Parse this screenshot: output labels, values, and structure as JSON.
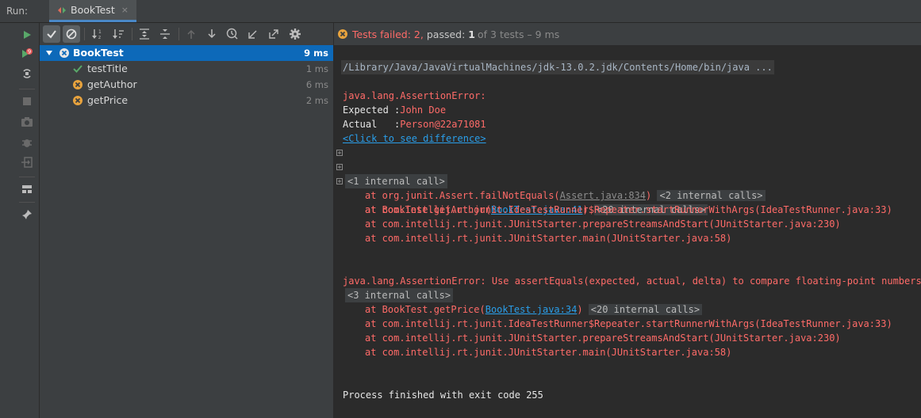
{
  "run_label": "Run:",
  "run_tab": {
    "label": "BookTest",
    "close": "×"
  },
  "tree": {
    "root": {
      "name": "BookTest",
      "time": "9 ms"
    },
    "children": [
      {
        "name": "testTitle",
        "time": "1 ms",
        "status": "passed"
      },
      {
        "name": "getAuthor",
        "time": "6 ms",
        "status": "failed"
      },
      {
        "name": "getPrice",
        "time": "2 ms",
        "status": "failed"
      }
    ]
  },
  "status": {
    "failed_text": "Tests failed: 2,",
    "passed_prefix": "passed:",
    "passed_count": "1",
    "of_text": "of 3 tests – 9 ms"
  },
  "console": {
    "command": "/Library/Java/JavaVirtualMachines/jdk-13.0.2.jdk/Contents/Home/bin/java ...",
    "err1": {
      "title": "java.lang.AssertionError:",
      "expected_label": "Expected :",
      "expected_value": "John Doe",
      "actual_label": "Actual   :",
      "actual_value": "Person@22a71081",
      "diff_link": "<Click to see difference>",
      "fold1": "<1 internal call>",
      "frame1_prefix": "at org.junit.Assert.failNotEquals(",
      "frame1_link": "Assert.java:834",
      "frame1_suffix": ")",
      "frame1_fold": "<2 internal calls>",
      "frame2_prefix": "at BookTest.getAuthor(",
      "frame2_link": "BookTest.java:41",
      "frame2_suffix": ")",
      "frame2_fold": "<20 internal calls>",
      "frame3": "at com.intellij.rt.junit.IdeaTestRunner$Repeater.startRunnerWithArgs(IdeaTestRunner.java:33)",
      "frame4": "at com.intellij.rt.junit.JUnitStarter.prepareStreamsAndStart(JUnitStarter.java:230)",
      "frame5": "at com.intellij.rt.junit.JUnitStarter.main(JUnitStarter.java:58)"
    },
    "err2": {
      "title": "java.lang.AssertionError: Use assertEquals(expected, actual, delta) to compare floating-point numbers",
      "fold1": "<3 internal calls>",
      "frame1_prefix": "at BookTest.getPrice(",
      "frame1_link": "BookTest.java:34",
      "frame1_suffix": ")",
      "frame1_fold": "<20 internal calls>",
      "frame2": "at com.intellij.rt.junit.IdeaTestRunner$Repeater.startRunnerWithArgs(IdeaTestRunner.java:33)",
      "frame3": "at com.intellij.rt.junit.JUnitStarter.prepareStreamsAndStart(JUnitStarter.java:230)",
      "frame4": "at com.intellij.rt.junit.JUnitStarter.main(JUnitStarter.java:58)"
    },
    "exit": "Process finished with exit code 255"
  },
  "colors": {
    "error": "#ff6b68",
    "link": "#2a9ee9",
    "selection": "#0d69b9",
    "pass": "#59a869",
    "fail_icon": "#e8a33d"
  },
  "icons": {
    "strip": [
      "rerun-icon",
      "rerun-failed-icon",
      "toggle-auto-test-icon",
      "stop-icon",
      "screenshot-icon",
      "debug-icon",
      "exit-icon",
      "layout-icon",
      "pin-icon"
    ],
    "toolbar": [
      "show-passed-icon",
      "show-ignored-icon",
      "sort-alpha-icon",
      "sort-duration-icon",
      "expand-all-icon",
      "collapse-all-icon",
      "prev-failed-icon",
      "next-failed-icon",
      "history-icon",
      "import-tests-icon",
      "export-tests-icon",
      "settings-icon"
    ]
  }
}
